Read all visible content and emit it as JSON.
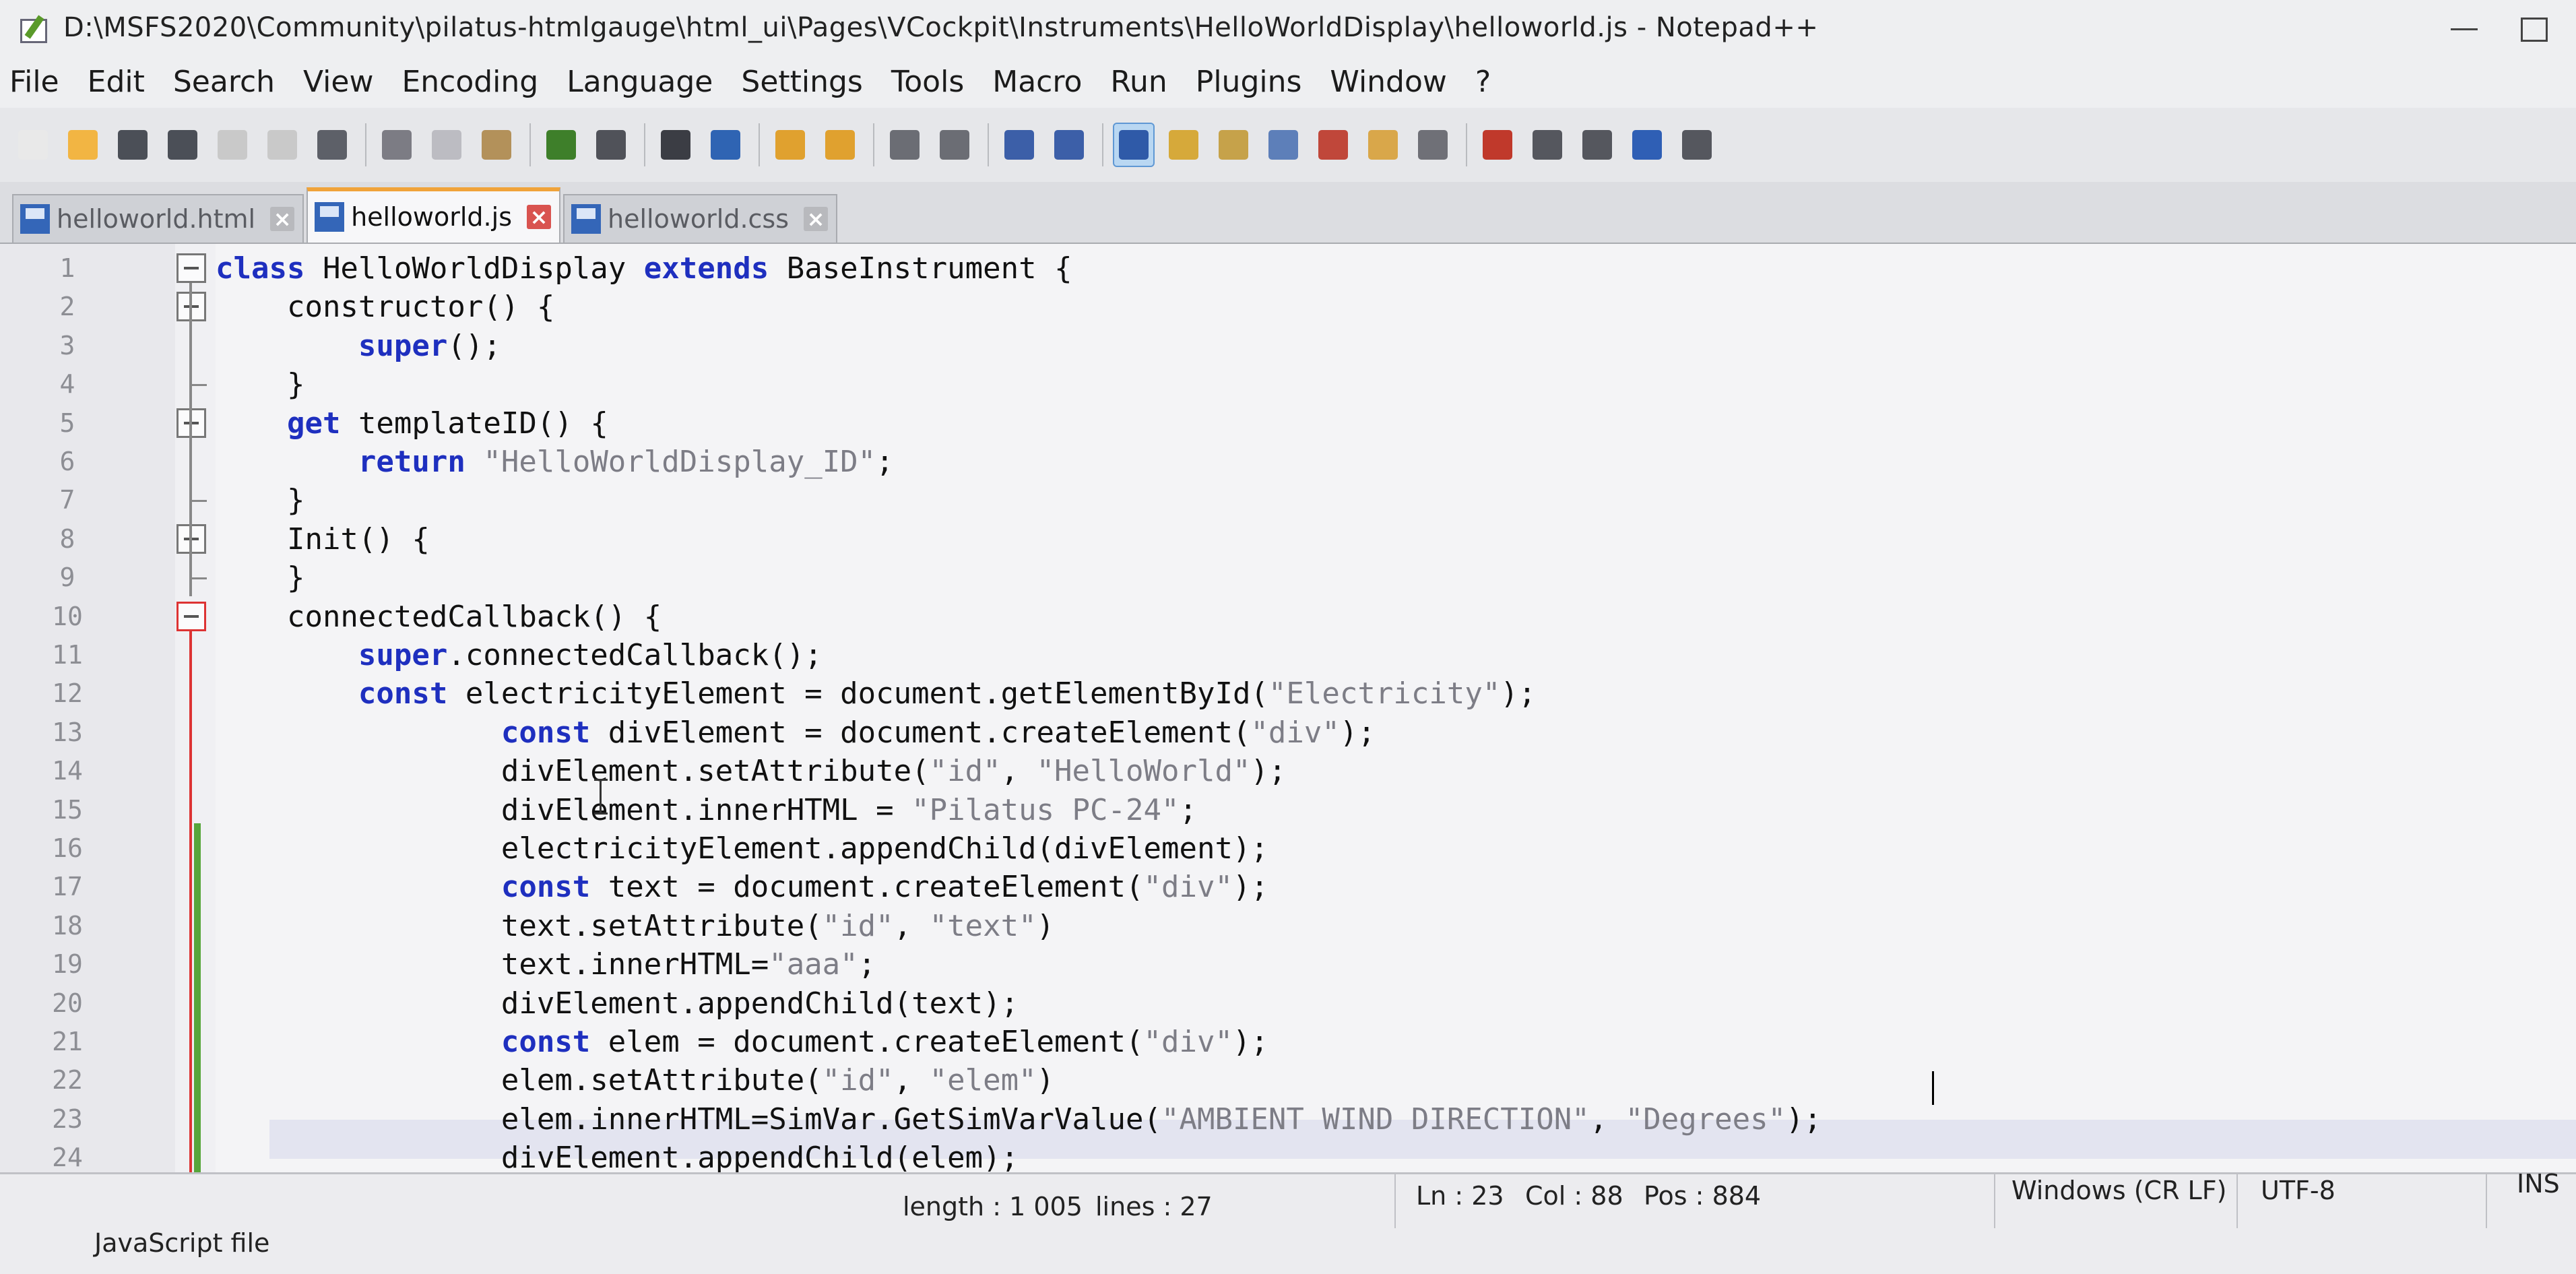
{
  "window": {
    "title": "D:\\MSFS2020\\Community\\pilatus-htmlgauge\\html_ui\\Pages\\VCockpit\\Instruments\\HelloWorldDisplay\\helloworld.js - Notepad++"
  },
  "menu": {
    "items": [
      {
        "label": "File"
      },
      {
        "label": "Edit"
      },
      {
        "label": "Search"
      },
      {
        "label": "View"
      },
      {
        "label": "Encoding"
      },
      {
        "label": "Language"
      },
      {
        "label": "Settings"
      },
      {
        "label": "Tools"
      },
      {
        "label": "Macro"
      },
      {
        "label": "Run"
      },
      {
        "label": "Plugins"
      },
      {
        "label": "Window"
      },
      {
        "label": "?"
      }
    ]
  },
  "toolbar": {
    "buttons": [
      {
        "icon": "new-file-icon",
        "color": "#e9e9e9"
      },
      {
        "icon": "open-folder-icon",
        "color": "#f2b543"
      },
      {
        "icon": "save-icon",
        "color": "#4b4f57"
      },
      {
        "icon": "save-all-icon",
        "color": "#4b4f57"
      },
      {
        "icon": "close-file-icon",
        "color": "#c9c9c9"
      },
      {
        "icon": "close-all-icon",
        "color": "#c9c9c9"
      },
      {
        "icon": "print-icon",
        "color": "#5d6068"
      },
      {
        "icon": "cut-icon",
        "color": "#7c7c84"
      },
      {
        "icon": "copy-icon",
        "color": "#bcbcc2"
      },
      {
        "icon": "paste-icon",
        "color": "#b3915a"
      },
      {
        "icon": "undo-icon",
        "color": "#3e7f2a"
      },
      {
        "icon": "redo-icon",
        "color": "#505259"
      },
      {
        "icon": "find-icon",
        "color": "#3b3d44"
      },
      {
        "icon": "replace-icon",
        "color": "#2f64b3"
      },
      {
        "icon": "zoom-in-icon",
        "color": "#e0a12f"
      },
      {
        "icon": "zoom-out-icon",
        "color": "#e0a12f"
      },
      {
        "icon": "sync-vertical-icon",
        "color": "#6b6d74"
      },
      {
        "icon": "sync-horizontal-icon",
        "color": "#6b6d74"
      },
      {
        "icon": "word-wrap-icon",
        "color": "#3c5fa8"
      },
      {
        "icon": "show-all-chars-icon",
        "color": "#3c5fa8"
      },
      {
        "icon": "indent-guide-icon",
        "color": "#2f5aa8"
      },
      {
        "icon": "user-language-icon",
        "color": "#d6a93a"
      },
      {
        "icon": "document-map-icon",
        "color": "#c6a24a"
      },
      {
        "icon": "document-list-icon",
        "color": "#5d7fb9"
      },
      {
        "icon": "function-list-icon",
        "color": "#c0473a"
      },
      {
        "icon": "folder-workspace-icon",
        "color": "#d9a74a"
      },
      {
        "icon": "monitoring-icon",
        "color": "#6f7077"
      },
      {
        "icon": "record-macro-icon",
        "color": "#c0392b"
      },
      {
        "icon": "stop-macro-icon",
        "color": "#55575e"
      },
      {
        "icon": "play-macro-icon",
        "color": "#55575e"
      },
      {
        "icon": "run-macro-multiple-icon",
        "color": "#2f5fb5"
      },
      {
        "icon": "save-macro-icon",
        "color": "#55575e"
      }
    ],
    "active_index": 20
  },
  "tabs": [
    {
      "label": "helloworld.html",
      "active": false
    },
    {
      "label": "helloworld.js",
      "active": true
    },
    {
      "label": "helloworld.css",
      "active": false
    }
  ],
  "editor": {
    "lines": [
      {
        "n": "1",
        "text": "class HelloWorldDisplay extends BaseInstrument {"
      },
      {
        "n": "2",
        "text": "    constructor() {"
      },
      {
        "n": "3",
        "text": "        super();"
      },
      {
        "n": "4",
        "text": "    }"
      },
      {
        "n": "5",
        "text": "    get templateID() {"
      },
      {
        "n": "6",
        "text": "        return \"HelloWorldDisplay_ID\";"
      },
      {
        "n": "7",
        "text": "    }"
      },
      {
        "n": "8",
        "text": "    Init() {"
      },
      {
        "n": "9",
        "text": "    }"
      },
      {
        "n": "10",
        "text": "    connectedCallback() {"
      },
      {
        "n": "11",
        "text": "        super.connectedCallback();"
      },
      {
        "n": "12",
        "text": "        const electricityElement = document.getElementById(\"Electricity\");"
      },
      {
        "n": "13",
        "text": "                const divElement = document.createElement(\"div\");"
      },
      {
        "n": "14",
        "text": "                divElement.setAttribute(\"id\", \"HelloWorld\");"
      },
      {
        "n": "15",
        "text": "                divElement.innerHTML = \"Pilatus PC-24\";"
      },
      {
        "n": "16",
        "text": "                electricityElement.appendChild(divElement);"
      },
      {
        "n": "17",
        "text": "                const text = document.createElement(\"div\");"
      },
      {
        "n": "18",
        "text": "                text.setAttribute(\"id\", \"text\")"
      },
      {
        "n": "19",
        "text": "                text.innerHTML=\"aaa\";"
      },
      {
        "n": "20",
        "text": "                divElement.appendChild(text);"
      },
      {
        "n": "21",
        "text": "                const elem = document.createElement(\"div\");"
      },
      {
        "n": "22",
        "text": "                elem.setAttribute(\"id\", \"elem\")"
      },
      {
        "n": "23",
        "text": "                elem.innerHTML=SimVar.GetSimVarValue(\"AMBIENT WIND DIRECTION\", \"Degrees\");"
      },
      {
        "n": "24",
        "text": "                divElement.appendChild(elem);"
      }
    ]
  },
  "status": {
    "file_type": "JavaScript file",
    "length": "length : 1 005",
    "lines": "lines : 27",
    "ln": "Ln : 23",
    "col": "Col : 88",
    "pos": "Pos : 884",
    "eol": "Windows (CR LF)",
    "encoding": "UTF-8",
    "mode": "INS"
  },
  "colors": {
    "keyword": "#1e2fbf",
    "string": "#7d7d86",
    "active_tab_accent": "#f0a33a",
    "change_bar": "#57a63b",
    "fold_active": "#d33333"
  }
}
